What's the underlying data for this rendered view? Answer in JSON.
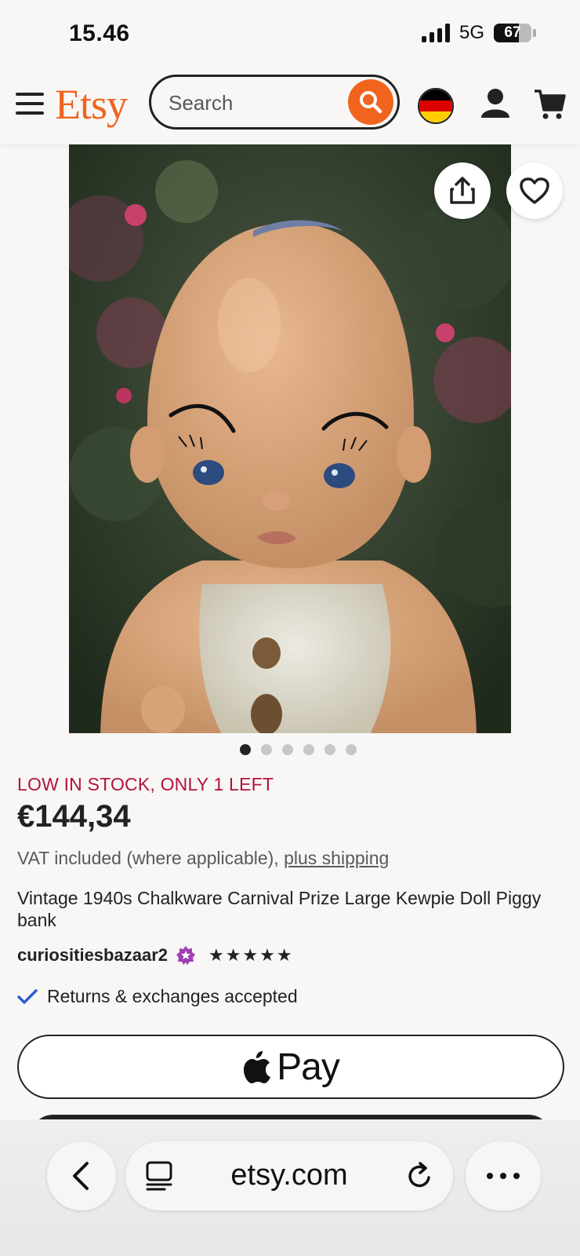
{
  "status": {
    "time": "15.46",
    "network": "5G",
    "battery": "67",
    "battery_level": 0.67
  },
  "header": {
    "logo": "Etsy",
    "search": {
      "placeholder": "Search",
      "value": ""
    },
    "flag_colors": [
      "#000000",
      "#dd0000",
      "#ffce00"
    ],
    "icons": [
      "menu-icon",
      "search-icon",
      "germany-flag-icon",
      "account-icon",
      "cart-icon"
    ]
  },
  "listing": {
    "image_icons": [
      "share-icon",
      "heart-icon"
    ],
    "image_count": 6,
    "active_image_index": 0,
    "stock_notice": "LOW IN STOCK, ONLY 1 LEFT",
    "price": "€144,34",
    "vat_text": "VAT included (where applicable), ",
    "shipping_link": "plus shipping",
    "title": "Vintage 1940s Chalkware Carnival Prize Large Kewpie Doll Piggy bank",
    "shop_name": "curiositiesbazaar2",
    "rating_stars": "★★★★★",
    "rating_value": 5,
    "returns": "Returns & exchanges accepted",
    "apple_pay_label": "Pay"
  },
  "browser": {
    "url": "etsy.com",
    "icons": [
      "back-icon",
      "tabs-icon",
      "reload-icon",
      "more-icon"
    ]
  },
  "colors": {
    "accent": "#f1641e",
    "stock_red": "#b3123a",
    "star_seller": "#a03fb2",
    "check_blue": "#2f5fce"
  }
}
